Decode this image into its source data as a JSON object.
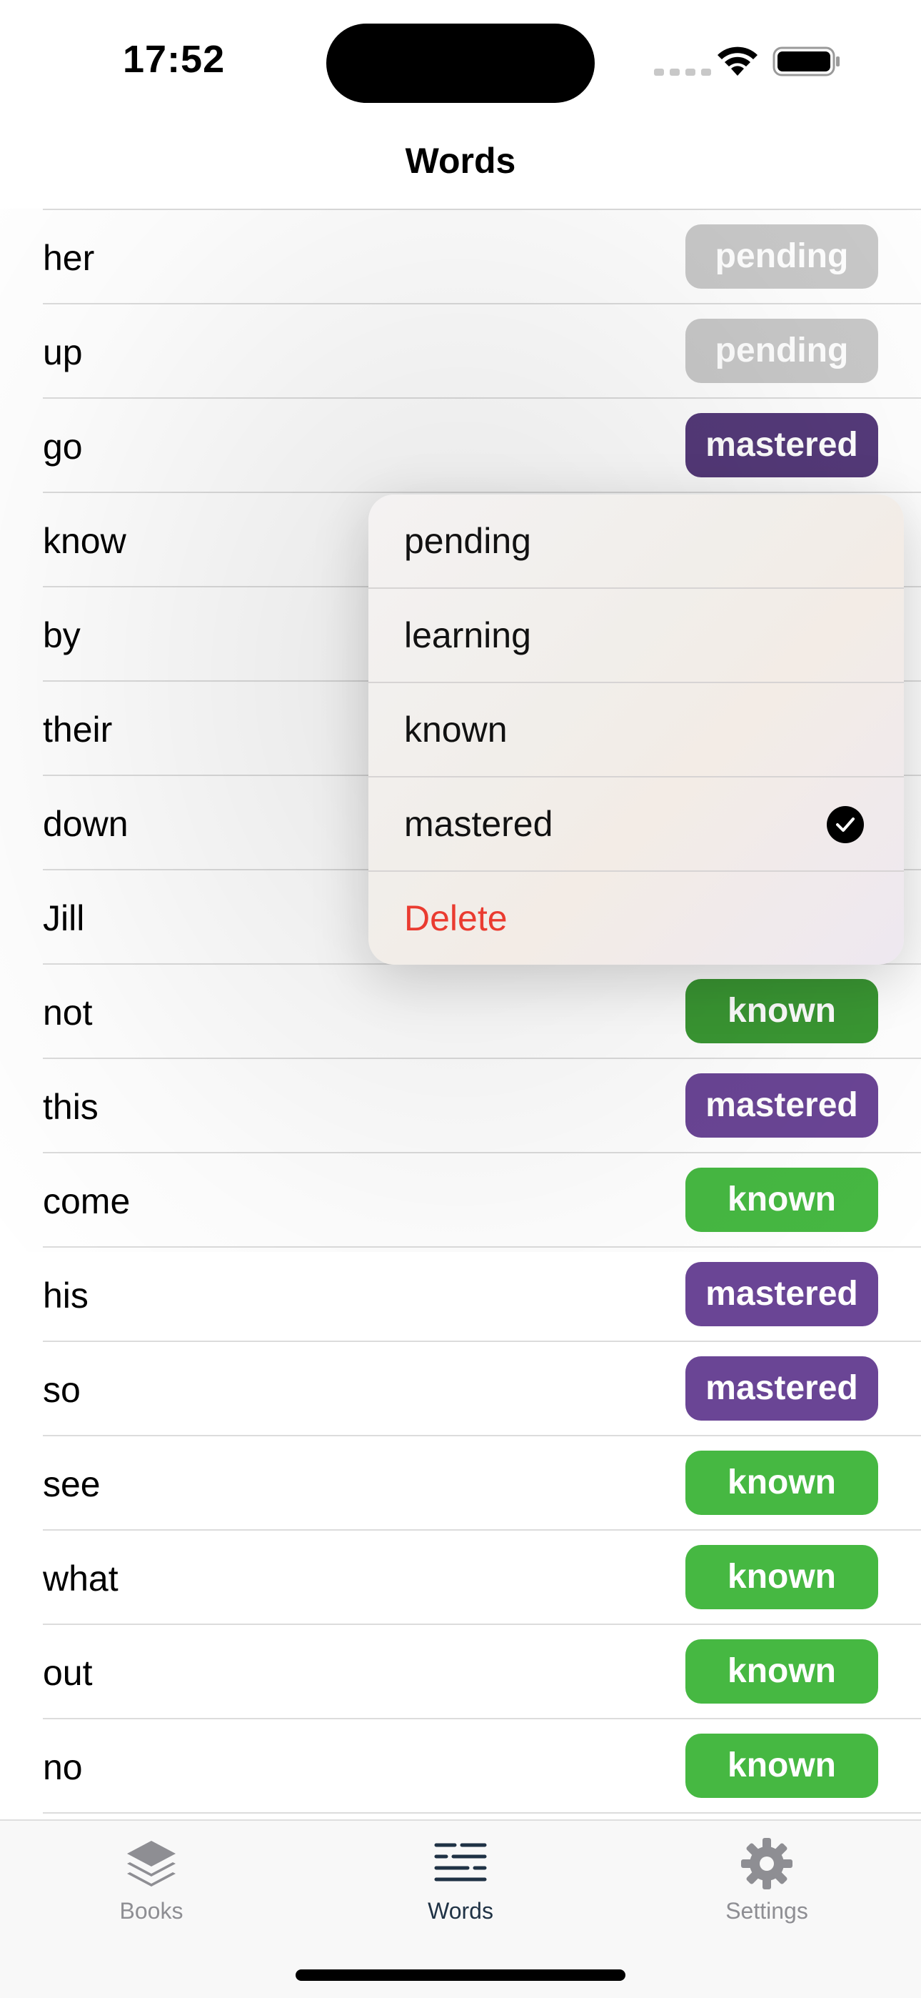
{
  "status_bar": {
    "time": "17:52"
  },
  "nav": {
    "title": "Words"
  },
  "rows": [
    {
      "word": "her",
      "status": "pending",
      "style": "pending"
    },
    {
      "word": "up",
      "status": "pending",
      "style": "pending"
    },
    {
      "word": "go",
      "status": "mastered",
      "style": "mastered-dim"
    },
    {
      "word": "know",
      "status": "",
      "style": ""
    },
    {
      "word": "by",
      "status": "",
      "style": ""
    },
    {
      "word": "their",
      "status": "",
      "style": ""
    },
    {
      "word": "down",
      "status": "",
      "style": ""
    },
    {
      "word": "Jill",
      "status": "",
      "style": ""
    },
    {
      "word": "not",
      "status": "known",
      "style": "known-dim"
    },
    {
      "word": "this",
      "status": "mastered",
      "style": "mastered"
    },
    {
      "word": "come",
      "status": "known",
      "style": "known"
    },
    {
      "word": "his",
      "status": "mastered",
      "style": "mastered"
    },
    {
      "word": "so",
      "status": "mastered",
      "style": "mastered"
    },
    {
      "word": "see",
      "status": "known",
      "style": "known"
    },
    {
      "word": "what",
      "status": "known",
      "style": "known"
    },
    {
      "word": "out",
      "status": "known",
      "style": "known"
    },
    {
      "word": "no",
      "status": "known",
      "style": "known"
    }
  ],
  "menu": {
    "items": [
      {
        "label": "pending",
        "checked": false
      },
      {
        "label": "learning",
        "checked": false
      },
      {
        "label": "known",
        "checked": false
      },
      {
        "label": "mastered",
        "checked": true
      },
      {
        "label": "Delete",
        "destructive": true
      }
    ]
  },
  "tabs": [
    {
      "label": "Books",
      "icon": "stack-icon",
      "active": false
    },
    {
      "label": "Words",
      "icon": "text-lines-icon",
      "active": true
    },
    {
      "label": "Settings",
      "icon": "gear-icon",
      "active": false
    }
  ],
  "colors": {
    "pending": "#c9c9c9",
    "known": "#46b842",
    "mastered": "#6a4595",
    "destructive": "#ea3b30",
    "tab_active": "#1f3245",
    "tab_inactive": "#8e8e93"
  }
}
